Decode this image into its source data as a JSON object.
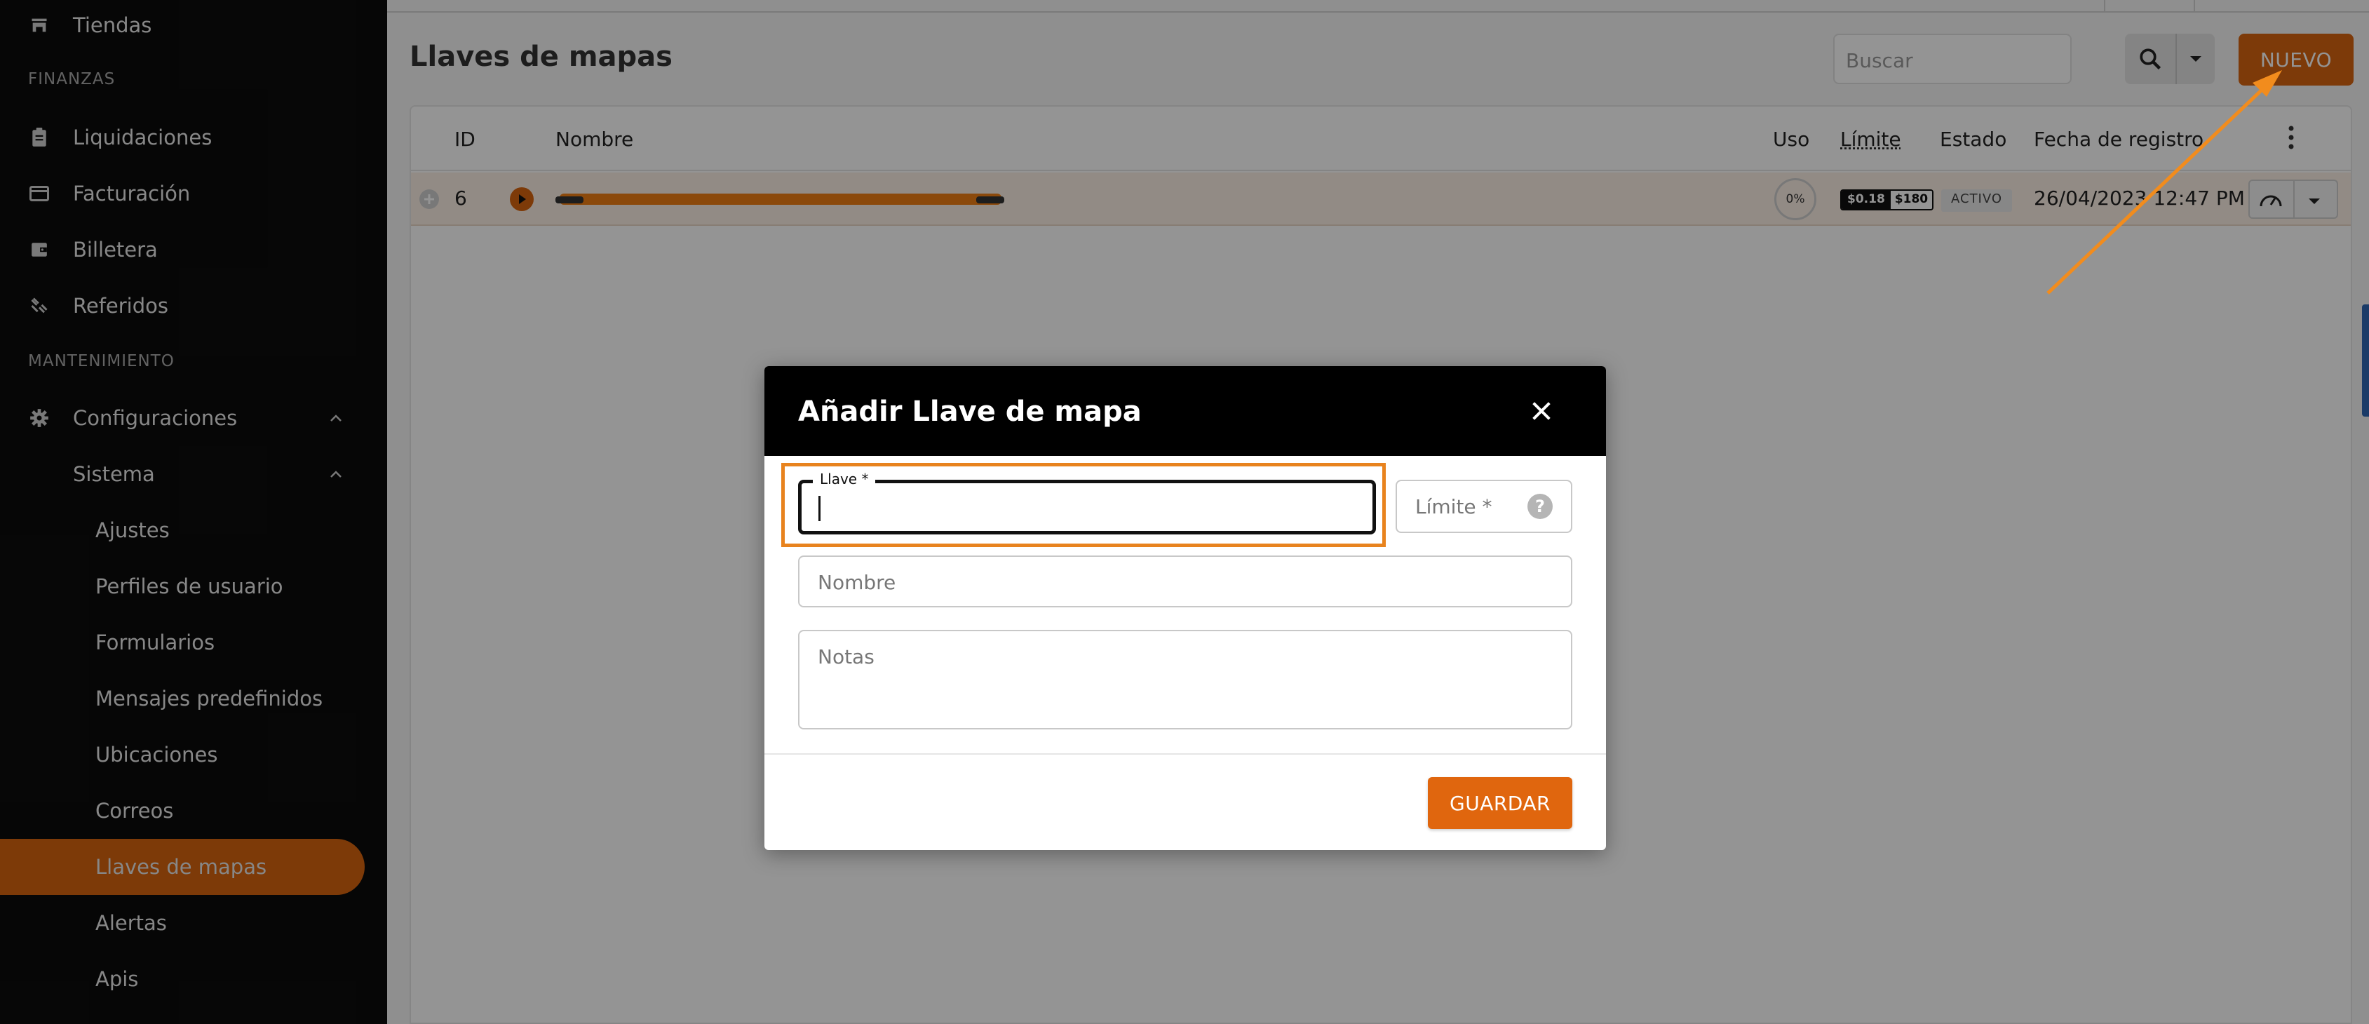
{
  "sidebar": {
    "items_top": {
      "tiendas": "Tiendas"
    },
    "section_finanzas": "FINANZAS",
    "liquidaciones": "Liquidaciones",
    "facturacion": "Facturación",
    "billetera": "Billetera",
    "referidos": "Referidos",
    "section_mantenimiento": "MANTENIMIENTO",
    "configuraciones": "Configuraciones",
    "sistema": "Sistema",
    "sub": {
      "ajustes": "Ajustes",
      "perfiles": "Perfiles de usuario",
      "formularios": "Formularios",
      "mensajes": "Mensajes predefinidos",
      "ubicaciones": "Ubicaciones",
      "correos": "Correos",
      "llaves": "Llaves de mapas",
      "alertas": "Alertas",
      "apis": "Apis"
    },
    "active_item": "Llaves de mapas"
  },
  "header": {
    "title": "Llaves de mapas",
    "search_placeholder": "Buscar",
    "new_button": "NUEVO"
  },
  "table": {
    "columns": {
      "id": "ID",
      "nombre": "Nombre",
      "uso": "Uso",
      "limite": "Límite",
      "estado": "Estado",
      "fecha": "Fecha de registro"
    },
    "rows": [
      {
        "id": "6",
        "uso": "0%",
        "limite_used": "$0.18",
        "limite_total": "$180",
        "estado": "ACTIVO",
        "fecha": "26/04/2023 12:47 PM"
      }
    ]
  },
  "modal": {
    "title": "Añadir Llave de mapa",
    "llave_label": "Llave *",
    "limite_placeholder": "Límite *",
    "nombre_placeholder": "Nombre",
    "notas_placeholder": "Notas",
    "save_button": "GUARDAR"
  },
  "colors": {
    "accent": "#d8650f",
    "highlight": "#e8831e",
    "modal_header": "#000000"
  }
}
